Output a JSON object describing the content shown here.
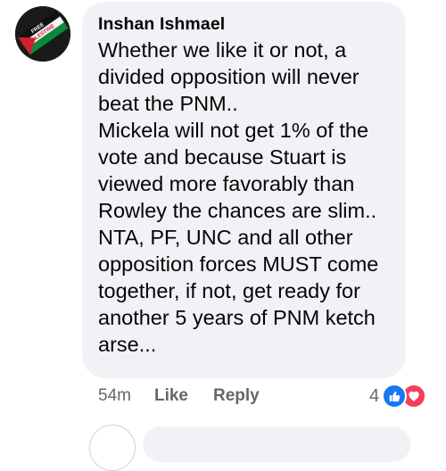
{
  "comment": {
    "author": "Inshan Ishmael",
    "avatar_icon": "free-palestine-flag-avatar-icon",
    "avatar_text": "FREE PALESTINE",
    "text_lines": [
      "Whether we like it or not, a",
      "divided opposition will never",
      "beat the PNM..",
      "Mickela will not get 1% of the",
      "vote and because Stuart is",
      "viewed more favorably than",
      "Rowley the chances are slim..",
      "NTA, PF, UNC and all other",
      "opposition forces MUST come",
      "together, if not, get ready for",
      "another 5 years of PNM ketch",
      "arse..."
    ]
  },
  "actions": {
    "time": "54m",
    "like_label": "Like",
    "reply_label": "Reply"
  },
  "reactions": {
    "count": "4",
    "icons": [
      "like-reaction-icon",
      "love-reaction-icon"
    ],
    "like_color": "#1877f2",
    "love_color": "#f33e58"
  },
  "colors": {
    "bubble_bg": "#f0f2f5",
    "text": "#050505",
    "secondary_text": "#65676b"
  }
}
